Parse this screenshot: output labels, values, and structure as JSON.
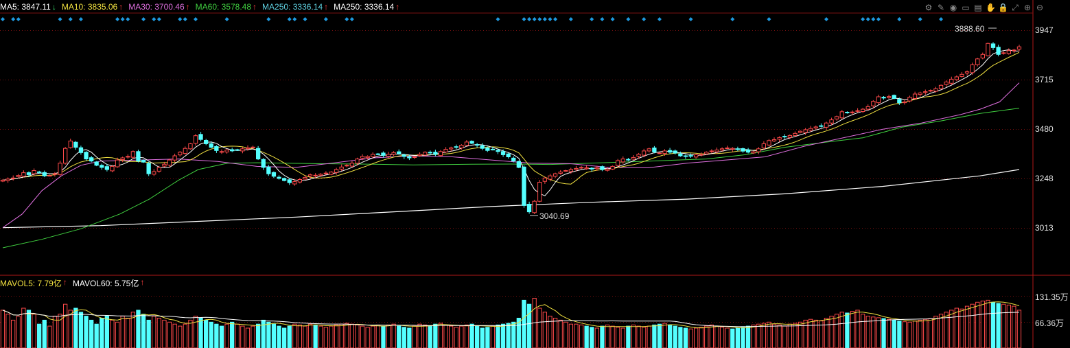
{
  "ma_legend": [
    {
      "label": "MA5: 3847.11",
      "arrow": "↓",
      "color": "#ffffff",
      "arrow_color": "#35e06a"
    },
    {
      "label": "MA10: 3835.06",
      "arrow": "↑",
      "color": "#f0e040",
      "arrow_color": "#ff4040"
    },
    {
      "label": "MA30: 3700.46",
      "arrow": "↑",
      "color": "#e070e0",
      "arrow_color": "#ff4040"
    },
    {
      "label": "MA60: 3578.48",
      "arrow": "↑",
      "color": "#40d040",
      "arrow_color": "#ff4040"
    },
    {
      "label": "MA250: 3336.14",
      "arrow": "↑",
      "color": "#5fd0e0",
      "arrow_color": "#ff4040"
    },
    {
      "label": "MA250: 3336.14",
      "arrow": "↑",
      "color": "#ffffff",
      "arrow_color": "#ff4040"
    }
  ],
  "vol_legend": [
    {
      "label": "MAVOL5: 7.79亿",
      "arrow": "↑",
      "color": "#f0e040",
      "arrow_color": "#ff4040"
    },
    {
      "label": "MAVOL60: 5.75亿",
      "arrow": "↑",
      "color": "#ffffff",
      "arrow_color": "#ff4040"
    }
  ],
  "toolbar_icons": [
    "gear-icon",
    "pencil-icon",
    "eye-icon",
    "window-icon",
    "calendar-icon",
    "hand-icon",
    "lock-icon",
    "fullscreen-icon",
    "zoom-in-icon",
    "zoom-out-icon"
  ],
  "annotations": {
    "high_label": "3888.60",
    "low_label": "3040.69"
  },
  "colors": {
    "up": "#ff4a4a",
    "down": "#54ffff",
    "grid": "#7a1010",
    "axis": "#b01818",
    "signal": "#1e9ae0"
  },
  "chart_data": {
    "type": "candlestick",
    "price_axis": {
      "ticks": [
        3013,
        3248,
        3480,
        3715,
        3947
      ],
      "tick_labels": [
        "3013",
        "3248",
        "3480",
        "3715",
        "3947"
      ],
      "range": [
        2800,
        4020
      ]
    },
    "volume_axis": {
      "tick_labels": [
        "131.35万",
        "66.36万"
      ],
      "ticks": [
        131.35,
        66.36
      ],
      "range": [
        0,
        150
      ]
    },
    "close_series": [
      3240,
      3245,
      3250,
      3262,
      3275,
      3266,
      3285,
      3278,
      3260,
      3262,
      3270,
      3320,
      3390,
      3425,
      3395,
      3370,
      3340,
      3330,
      3310,
      3300,
      3290,
      3305,
      3335,
      3345,
      3352,
      3375,
      3330,
      3325,
      3270,
      3280,
      3300,
      3315,
      3335,
      3355,
      3372,
      3390,
      3412,
      3450,
      3432,
      3412,
      3395,
      3380,
      3375,
      3382,
      3378,
      3382,
      3388,
      3392,
      3396,
      3340,
      3300,
      3270,
      3258,
      3248,
      3238,
      3228,
      3233,
      3243,
      3253,
      3265,
      3263,
      3268,
      3273,
      3278,
      3290,
      3302,
      3310,
      3320,
      3340,
      3352,
      3352,
      3362,
      3362,
      3357,
      3362,
      3370,
      3365,
      3352,
      3345,
      3350,
      3362,
      3372,
      3368,
      3362,
      3375,
      3385,
      3392,
      3396,
      3405,
      3420,
      3414,
      3405,
      3390,
      3380,
      3385,
      3375,
      3360,
      3350,
      3330,
      3300,
      3120,
      3090,
      3140,
      3230,
      3250,
      3260,
      3270,
      3278,
      3285,
      3290,
      3295,
      3300,
      3298,
      3292,
      3298,
      3290,
      3292,
      3305,
      3332,
      3340,
      3337,
      3347,
      3362,
      3378,
      3388,
      3373,
      3368,
      3378,
      3372,
      3368,
      3355,
      3352,
      3355,
      3360,
      3362,
      3372,
      3378,
      3382,
      3388,
      3392,
      3390,
      3387,
      3377,
      3372,
      3374,
      3388,
      3412,
      3427,
      3431,
      3441,
      3446,
      3451,
      3461,
      3471,
      3478,
      3484,
      3491,
      3494,
      3510,
      3525,
      3540,
      3563,
      3558,
      3562,
      3568,
      3575,
      3587,
      3612,
      3634,
      3628,
      3635,
      3626,
      3606,
      3610,
      3632,
      3647,
      3652,
      3658,
      3664,
      3672,
      3688,
      3704,
      3717,
      3728,
      3740,
      3752,
      3785,
      3813,
      3834,
      3886,
      3866,
      3834,
      3842,
      3852,
      3855,
      3870
    ],
    "ma_series": [
      {
        "name": "MA5",
        "color": "#ffffff"
      },
      {
        "name": "MA10",
        "color": "#f0e040"
      },
      {
        "name": "MA30",
        "color": "#e070e0"
      },
      {
        "name": "MA60",
        "color": "#40d040"
      },
      {
        "name": "MA250",
        "color": "#ffffff"
      }
    ],
    "ma60_points": [
      [
        0,
        2920
      ],
      [
        40,
        2960
      ],
      [
        80,
        3010
      ],
      [
        120,
        3080
      ],
      [
        150,
        3150
      ],
      [
        180,
        3240
      ],
      [
        200,
        3290
      ],
      [
        230,
        3320
      ],
      [
        260,
        3322
      ],
      [
        320,
        3318
      ],
      [
        380,
        3315
      ],
      [
        420,
        3312
      ],
      [
        480,
        3315
      ],
      [
        520,
        3316
      ],
      [
        560,
        3314
      ],
      [
        600,
        3320
      ],
      [
        640,
        3326
      ],
      [
        680,
        3333
      ],
      [
        720,
        3340
      ],
      [
        760,
        3360
      ],
      [
        800,
        3395
      ],
      [
        840,
        3418
      ],
      [
        880,
        3440
      ],
      [
        920,
        3490
      ],
      [
        960,
        3520
      ],
      [
        1000,
        3555
      ],
      [
        1040,
        3580
      ]
    ],
    "ma250_points": [
      [
        0,
        3015
      ],
      [
        100,
        3025
      ],
      [
        200,
        3045
      ],
      [
        300,
        3065
      ],
      [
        400,
        3090
      ],
      [
        500,
        3115
      ],
      [
        600,
        3135
      ],
      [
        700,
        3150
      ],
      [
        800,
        3175
      ],
      [
        900,
        3210
      ],
      [
        1000,
        3260
      ],
      [
        1040,
        3290
      ]
    ],
    "ma30_points": [
      [
        0,
        3015
      ],
      [
        20,
        3080
      ],
      [
        40,
        3190
      ],
      [
        60,
        3260
      ],
      [
        80,
        3310
      ],
      [
        100,
        3330
      ],
      [
        140,
        3335
      ],
      [
        180,
        3340
      ],
      [
        220,
        3328
      ],
      [
        260,
        3305
      ],
      [
        300,
        3300
      ],
      [
        340,
        3322
      ],
      [
        380,
        3345
      ],
      [
        420,
        3355
      ],
      [
        460,
        3350
      ],
      [
        500,
        3335
      ],
      [
        540,
        3320
      ],
      [
        580,
        3318
      ],
      [
        620,
        3300
      ],
      [
        660,
        3298
      ],
      [
        700,
        3320
      ],
      [
        740,
        3335
      ],
      [
        780,
        3350
      ],
      [
        820,
        3400
      ],
      [
        860,
        3440
      ],
      [
        900,
        3480
      ],
      [
        940,
        3510
      ],
      [
        980,
        3550
      ],
      [
        1000,
        3575
      ],
      [
        1020,
        3610
      ],
      [
        1040,
        3700
      ]
    ],
    "volume_values": [
      95,
      85,
      70,
      80,
      100,
      95,
      85,
      60,
      70,
      55,
      80,
      85,
      110,
      95,
      100,
      90,
      80,
      70,
      60,
      75,
      80,
      70,
      65,
      80,
      75,
      90,
      95,
      85,
      70,
      80,
      75,
      70,
      65,
      60,
      55,
      60,
      70,
      80,
      75,
      70,
      65,
      60,
      55,
      60,
      65,
      60,
      55,
      50,
      55,
      60,
      70,
      65,
      60,
      55,
      50,
      55,
      60,
      58,
      55,
      60,
      58,
      55,
      52,
      55,
      58,
      60,
      62,
      60,
      58,
      55,
      52,
      55,
      58,
      55,
      58,
      60,
      55,
      52,
      50,
      55,
      60,
      58,
      55,
      60,
      62,
      58,
      55,
      52,
      55,
      58,
      60,
      55,
      50,
      52,
      55,
      58,
      60,
      62,
      65,
      75,
      120,
      110,
      125,
      100,
      90,
      80,
      75,
      70,
      65,
      60,
      60,
      58,
      55,
      52,
      50,
      55,
      58,
      55,
      52,
      50,
      55,
      58,
      55,
      52,
      55,
      58,
      60,
      62,
      58,
      55,
      52,
      50,
      48,
      50,
      52,
      55,
      58,
      55,
      52,
      50,
      48,
      50,
      52,
      55,
      58,
      60,
      62,
      65,
      60,
      58,
      55,
      60,
      62,
      65,
      70,
      72,
      70,
      68,
      75,
      80,
      85,
      90,
      88,
      92,
      95,
      85,
      80,
      78,
      76,
      74,
      72,
      70,
      68,
      66,
      65,
      68,
      70,
      72,
      74,
      80,
      85,
      90,
      95,
      100,
      98,
      105,
      110,
      115,
      118,
      120,
      115,
      112,
      110,
      108,
      105
    ]
  }
}
